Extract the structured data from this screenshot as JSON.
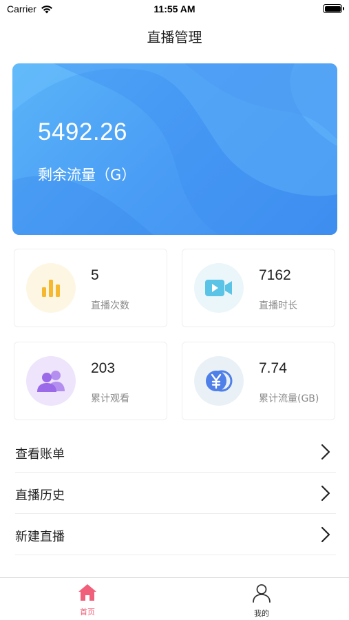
{
  "status_bar": {
    "carrier": "Carrier",
    "time": "11:55 AM"
  },
  "nav": {
    "title": "直播管理"
  },
  "hero": {
    "value": "5492.26",
    "label": "剩余流量（G）"
  },
  "stats": [
    {
      "value": "5",
      "label": "直播次数",
      "icon": "bar-chart-icon",
      "icon_bg": "#fdf6e3",
      "icon_color": "#f5b82e"
    },
    {
      "value": "7162",
      "label": "直播时长",
      "icon": "video-camera-icon",
      "icon_bg": "#eaf6f9",
      "icon_color": "#5bc3e6"
    },
    {
      "value": "203",
      "label": "累计观看",
      "icon": "users-icon",
      "icon_bg": "#eee4fb",
      "icon_color": "#9a6ae8"
    },
    {
      "value": "7.74",
      "label": "累计流量(GB)",
      "icon": "yen-coin-icon",
      "icon_bg": "#e9f1f7",
      "icon_color": "#4f7fe8"
    }
  ],
  "menu": [
    {
      "label": "查看账单"
    },
    {
      "label": "直播历史"
    },
    {
      "label": "新建直播"
    }
  ],
  "tab_bar": {
    "items": [
      {
        "label": "首页",
        "icon": "home-icon",
        "active": true
      },
      {
        "label": "我的",
        "icon": "user-icon",
        "active": false
      }
    ],
    "active_color": "#f0607a",
    "inactive_color": "#333333"
  }
}
